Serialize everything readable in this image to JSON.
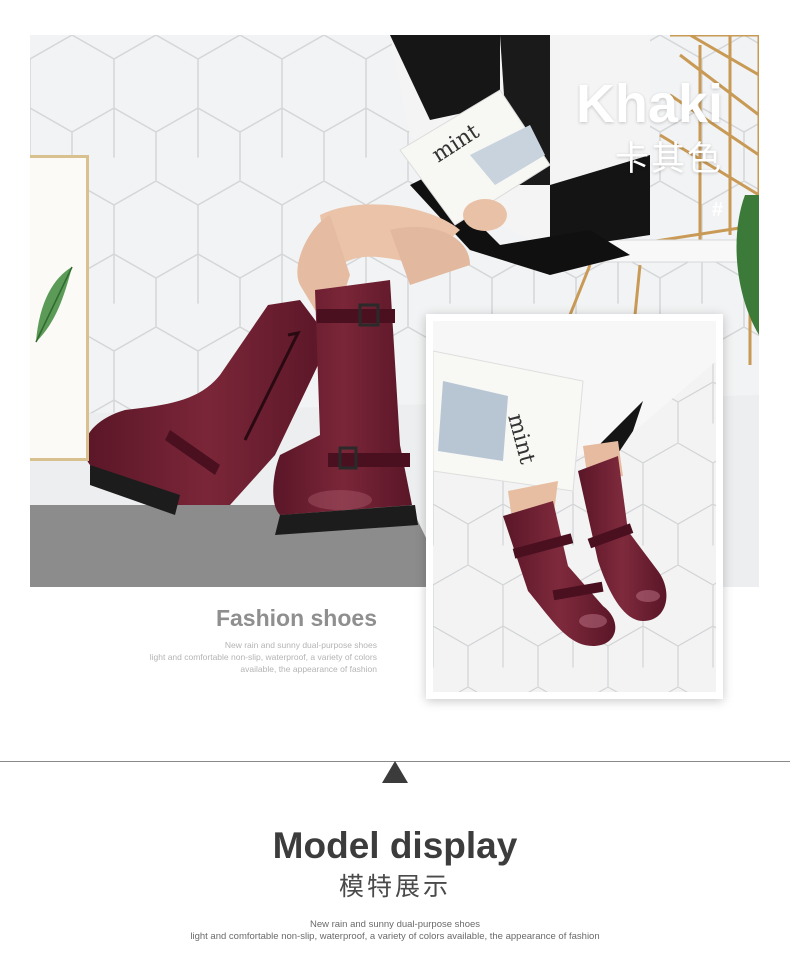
{
  "hero": {
    "title": "Khaki",
    "subtitle": "卡其色",
    "mark": "#",
    "book_text": "mint",
    "boot_color": "#6d1f33",
    "floor_color": "#8c8c8c"
  },
  "inset": {
    "book_text": "mint"
  },
  "caption": {
    "title": "Fashion shoes",
    "lines": [
      "New rain and sunny dual-purpose shoes",
      "light and comfortable non-slip, waterproof, a variety of colors",
      "available, the appearance of fashion"
    ]
  },
  "section": {
    "title": "Model display",
    "subtitle": "模特展示",
    "lines": [
      "New rain and sunny dual-purpose shoes",
      "light and comfortable non-slip, waterproof, a variety of colors available, the appearance of fashion"
    ]
  },
  "icons": {
    "divider_arrow": "triangle-up-icon"
  }
}
